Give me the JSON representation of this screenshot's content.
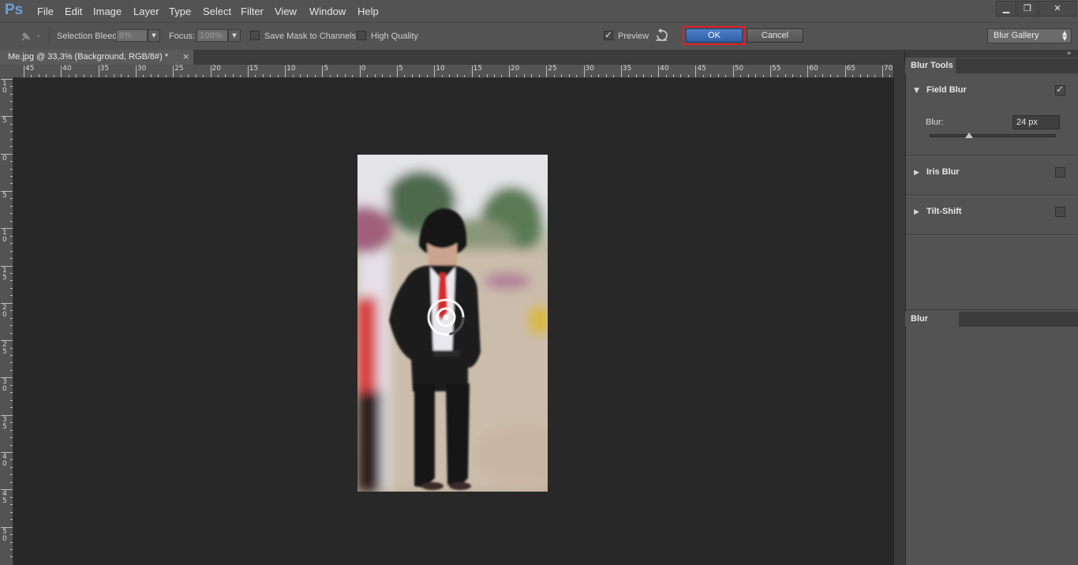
{
  "app": {
    "logo": "Ps"
  },
  "menu": [
    "File",
    "Edit",
    "Image",
    "Layer",
    "Type",
    "Select",
    "Filter",
    "View",
    "Window",
    "Help"
  ],
  "window_controls": {
    "minimize": "▁",
    "restore": "❐",
    "close": "✕"
  },
  "options_bar": {
    "selection_bleed_label": "Selection Bleed:",
    "selection_bleed_value": "0%",
    "focus_label": "Focus:",
    "focus_value": "100%",
    "save_mask_label": "Save Mask to Channels",
    "save_mask_checked": false,
    "high_quality_label": "High Quality",
    "high_quality_checked": false,
    "preview_label": "Preview",
    "preview_checked": true,
    "ok_label": "OK",
    "cancel_label": "Cancel",
    "workspace_label": "Blur Gallery"
  },
  "document_tab": {
    "title": "Me.jpg @ 33,3% (Background, RGB/8#) *",
    "close": "×"
  },
  "ruler": {
    "horizontal_labels": [
      "45",
      "40",
      "35",
      "30",
      "25",
      "20",
      "15",
      "10",
      "5",
      "0",
      "5",
      "10",
      "15",
      "20",
      "25",
      "30",
      "35",
      "40",
      "45",
      "50",
      "55",
      "60",
      "65",
      "70"
    ],
    "vertical_labels": [
      "1 0",
      "5",
      "0",
      "5",
      "1 0",
      "1 5",
      "2 0",
      "2 5",
      "3 0",
      "3 5",
      "4 0",
      "4 5",
      "5 0"
    ]
  },
  "panels": {
    "blur_tools": {
      "tab_label": "Blur Tools",
      "field_blur": {
        "label": "Field Blur",
        "checked": true,
        "blur_label": "Blur:",
        "blur_value": "24 px",
        "blur_level_fraction": 0.31
      },
      "iris_blur": {
        "label": "Iris Blur",
        "checked": false
      },
      "tilt_shift": {
        "label": "Tilt-Shift",
        "checked": false
      }
    },
    "blur_effects": {
      "tab_label": "Blur Effects"
    },
    "collapse_icon": "»"
  },
  "colors": {
    "ok_highlight": "#e31e24",
    "ok_button": "#3c6fb8",
    "panel": "#535353",
    "canvas": "#282828"
  }
}
